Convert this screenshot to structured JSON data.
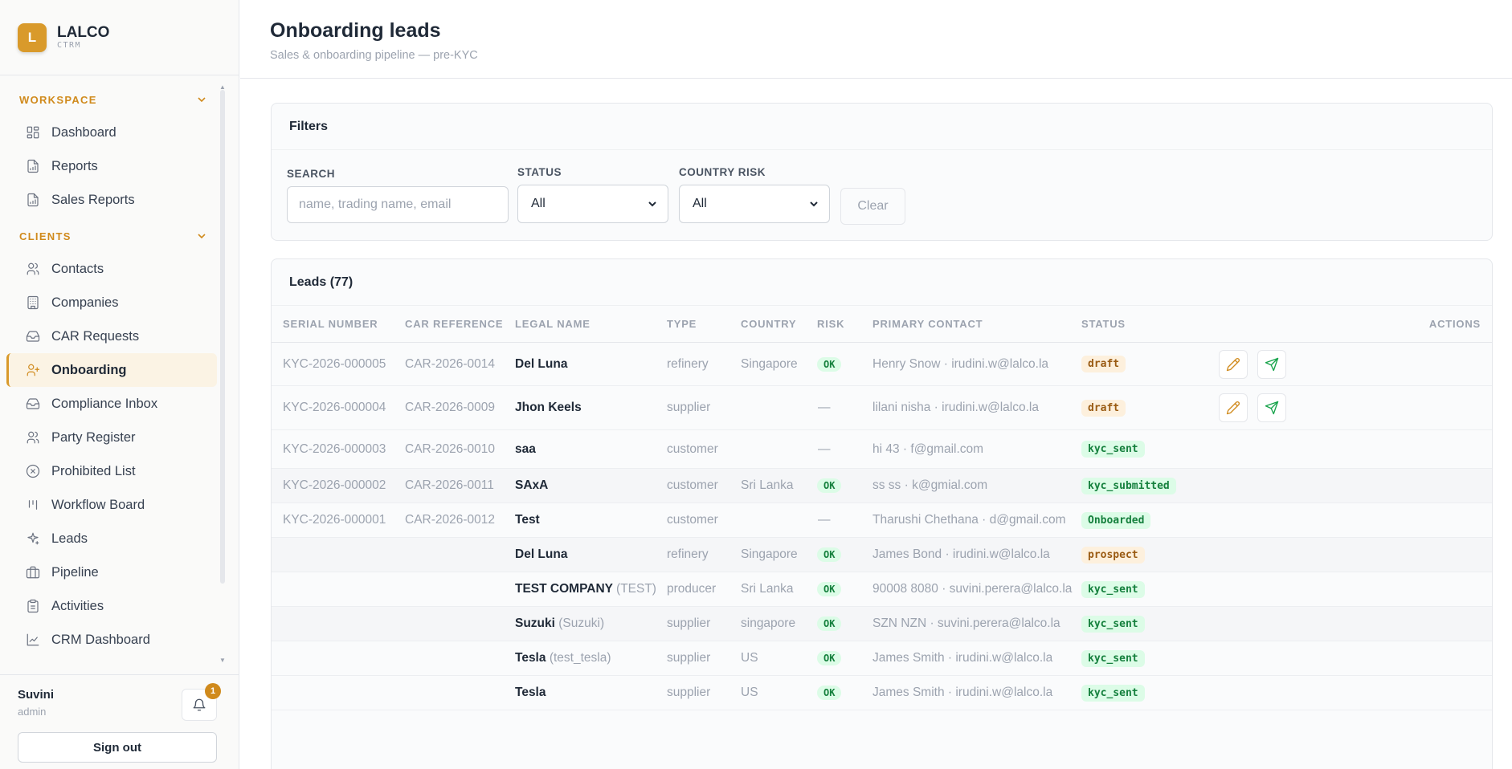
{
  "brand": {
    "logo_letter": "L",
    "name": "LALCO",
    "sub": "CTRM"
  },
  "nav": {
    "workspace_label": "WORKSPACE",
    "clients_label": "CLIENTS",
    "workspace_items": [
      {
        "label": "Dashboard",
        "icon": "grid-icon"
      },
      {
        "label": "Reports",
        "icon": "file-chart-icon"
      },
      {
        "label": "Sales Reports",
        "icon": "file-chart-icon"
      }
    ],
    "clients_items": [
      {
        "label": "Contacts",
        "icon": "users-icon"
      },
      {
        "label": "Companies",
        "icon": "building-icon"
      },
      {
        "label": "CAR Requests",
        "icon": "inbox-icon"
      },
      {
        "label": "Onboarding",
        "icon": "user-plus-icon",
        "active": true
      },
      {
        "label": "Compliance Inbox",
        "icon": "inbox-icon"
      },
      {
        "label": "Party Register",
        "icon": "users-icon"
      },
      {
        "label": "Prohibited List",
        "icon": "x-circle-icon"
      },
      {
        "label": "Workflow Board",
        "icon": "kanban-icon"
      },
      {
        "label": "Leads",
        "icon": "sparkles-icon"
      },
      {
        "label": "Pipeline",
        "icon": "briefcase-icon"
      },
      {
        "label": "Activities",
        "icon": "clipboard-icon"
      },
      {
        "label": "CRM Dashboard",
        "icon": "line-chart-icon"
      }
    ]
  },
  "user": {
    "name": "Suvini",
    "role": "admin",
    "notifications": "1",
    "signout_label": "Sign out"
  },
  "header": {
    "title": "Onboarding leads",
    "subtitle": "Sales & onboarding pipeline — pre-KYC"
  },
  "filters": {
    "title": "Filters",
    "search_label": "SEARCH",
    "search_placeholder": "name, trading name, email",
    "status_label": "STATUS",
    "status_value": "All",
    "country_risk_label": "COUNTRY RISK",
    "country_risk_value": "All",
    "clear_label": "Clear"
  },
  "leads": {
    "title": "Leads (77)",
    "columns": [
      "SERIAL NUMBER",
      "CAR REFERENCE",
      "LEGAL NAME",
      "TYPE",
      "COUNTRY",
      "RISK",
      "PRIMARY CONTACT",
      "STATUS",
      "ACTIONS"
    ],
    "rows": [
      {
        "serial": "KYC-2026-000005",
        "car": "CAR-2026-0014",
        "legal": "Del Luna",
        "trade": "",
        "type": "refinery",
        "country": "Singapore",
        "risk": "OK",
        "contact": "Henry Snow · irudini.w@lalco.la",
        "status": "draft",
        "actions": true
      },
      {
        "serial": "KYC-2026-000004",
        "car": "CAR-2026-0009",
        "legal": "Jhon Keels",
        "trade": "",
        "type": "supplier",
        "country": "",
        "risk": "—",
        "contact": "lilani nisha · irudini.w@lalco.la",
        "status": "draft",
        "actions": true
      },
      {
        "serial": "KYC-2026-000003",
        "car": "CAR-2026-0010",
        "legal": "saa",
        "trade": "",
        "type": "customer",
        "country": "",
        "risk": "—",
        "contact": "hi 43 · f@gmail.com",
        "status": "kyc_sent",
        "actions": false
      },
      {
        "serial": "KYC-2026-000002",
        "car": "CAR-2026-0011",
        "legal": "SAxA",
        "trade": "",
        "type": "customer",
        "country": "Sri Lanka",
        "risk": "OK",
        "contact": "ss ss · k@gmial.com",
        "status": "kyc_submitted",
        "actions": false
      },
      {
        "serial": "KYC-2026-000001",
        "car": "CAR-2026-0012",
        "legal": "Test",
        "trade": "",
        "type": "customer",
        "country": "",
        "risk": "—",
        "contact": "Tharushi Chethana · d@gmail.com",
        "status": "Onboarded",
        "actions": false
      },
      {
        "serial": "",
        "car": "",
        "legal": "Del Luna",
        "trade": "",
        "type": "refinery",
        "country": "Singapore",
        "risk": "OK",
        "contact": "James Bond · irudini.w@lalco.la",
        "status": "prospect",
        "actions": false
      },
      {
        "serial": "",
        "car": "",
        "legal": "TEST COMPANY",
        "trade": "(TEST)",
        "type": "producer",
        "country": "Sri Lanka",
        "risk": "OK",
        "contact": "90008 8080 · suvini.perera@lalco.la",
        "status": "kyc_sent",
        "actions": false
      },
      {
        "serial": "",
        "car": "",
        "legal": "Suzuki",
        "trade": "(Suzuki)",
        "type": "supplier",
        "country": "singapore",
        "risk": "OK",
        "contact": "SZN NZN · suvini.perera@lalco.la",
        "status": "kyc_sent",
        "actions": false
      },
      {
        "serial": "",
        "car": "",
        "legal": "Tesla",
        "trade": "(test_tesla)",
        "type": "supplier",
        "country": "US",
        "risk": "OK",
        "contact": "James Smith · irudini.w@lalco.la",
        "status": "kyc_sent",
        "actions": false
      },
      {
        "serial": "",
        "car": "",
        "legal": "Tesla",
        "trade": "",
        "type": "supplier",
        "country": "US",
        "risk": "OK",
        "contact": "James Smith · irudini.w@lalco.la",
        "status": "kyc_sent",
        "actions": false
      }
    ]
  },
  "colors": {
    "accent": "#d99a2b",
    "accent_text": "#d08a1c",
    "ok_bg": "#dcfce7",
    "ok_text": "#15803d",
    "draft_bg": "#fdf0dd",
    "draft_text": "#9a5b13"
  }
}
